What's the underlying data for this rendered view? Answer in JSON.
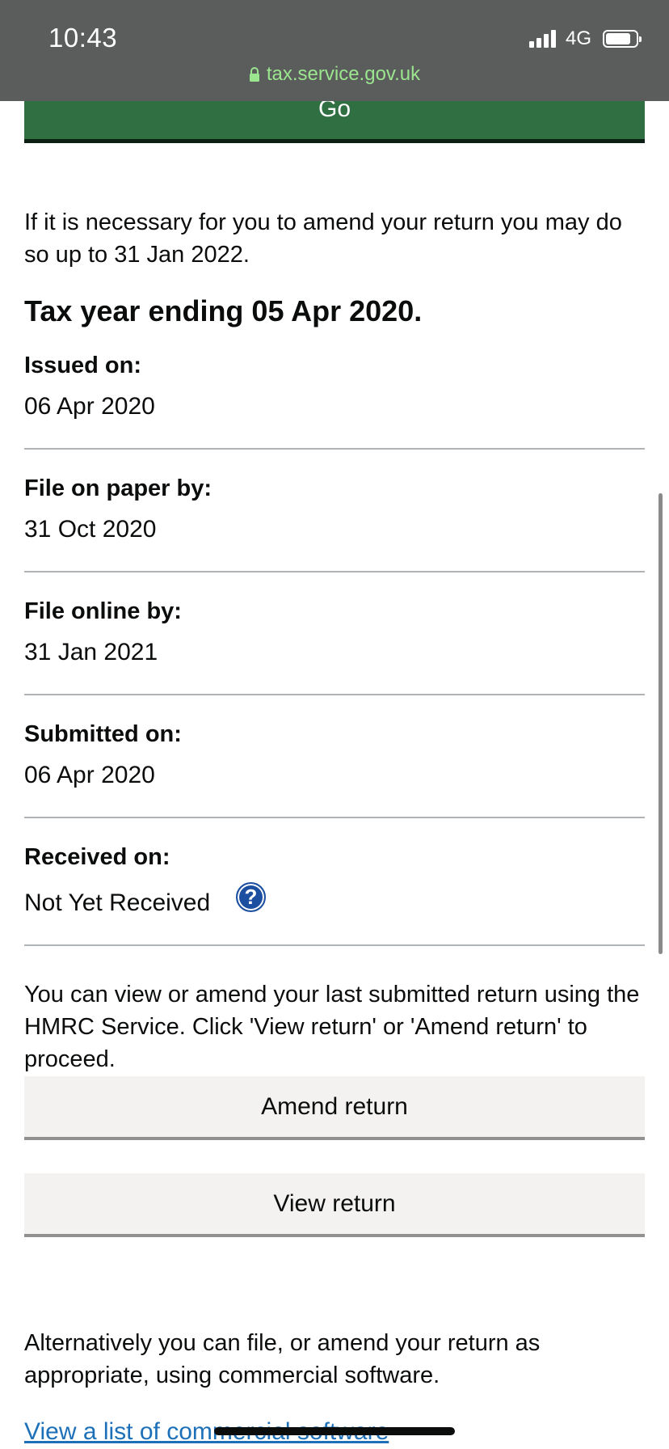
{
  "status_bar": {
    "time": "10:43",
    "network": "4G"
  },
  "browser": {
    "url": "tax.service.gov.uk"
  },
  "page": {
    "go_button_label": "Go",
    "intro_text": "If it is necessary for you to amend your return you may do so up to 31 Jan 2022.",
    "tax_year_heading": "Tax year ending 05 Apr 2020.",
    "fields": [
      {
        "label": "Issued on:",
        "value": "06 Apr 2020"
      },
      {
        "label": "File on paper by:",
        "value": "31 Oct 2020"
      },
      {
        "label": "File online by:",
        "value": "31 Jan 2021"
      },
      {
        "label": "Submitted on:",
        "value": "06 Apr 2020"
      },
      {
        "label": "Received on:",
        "value": "Not Yet Received"
      }
    ],
    "help_icon_glyph": "?",
    "info_text": "You can view or amend your last submitted return using the HMRC Service. Click 'View return' or 'Amend return' to proceed.",
    "amend_button_label": "Amend return",
    "view_button_label": "View return",
    "alternative_text": "Alternatively you can file, or amend your return as appropriate, using commercial software.",
    "software_link_text": "View a list of commercial software"
  },
  "colors": {
    "primary_button": "#2f6f42",
    "link": "#1d70b8",
    "help_icon": "#1d4fa0",
    "url_text": "#9be58f"
  }
}
